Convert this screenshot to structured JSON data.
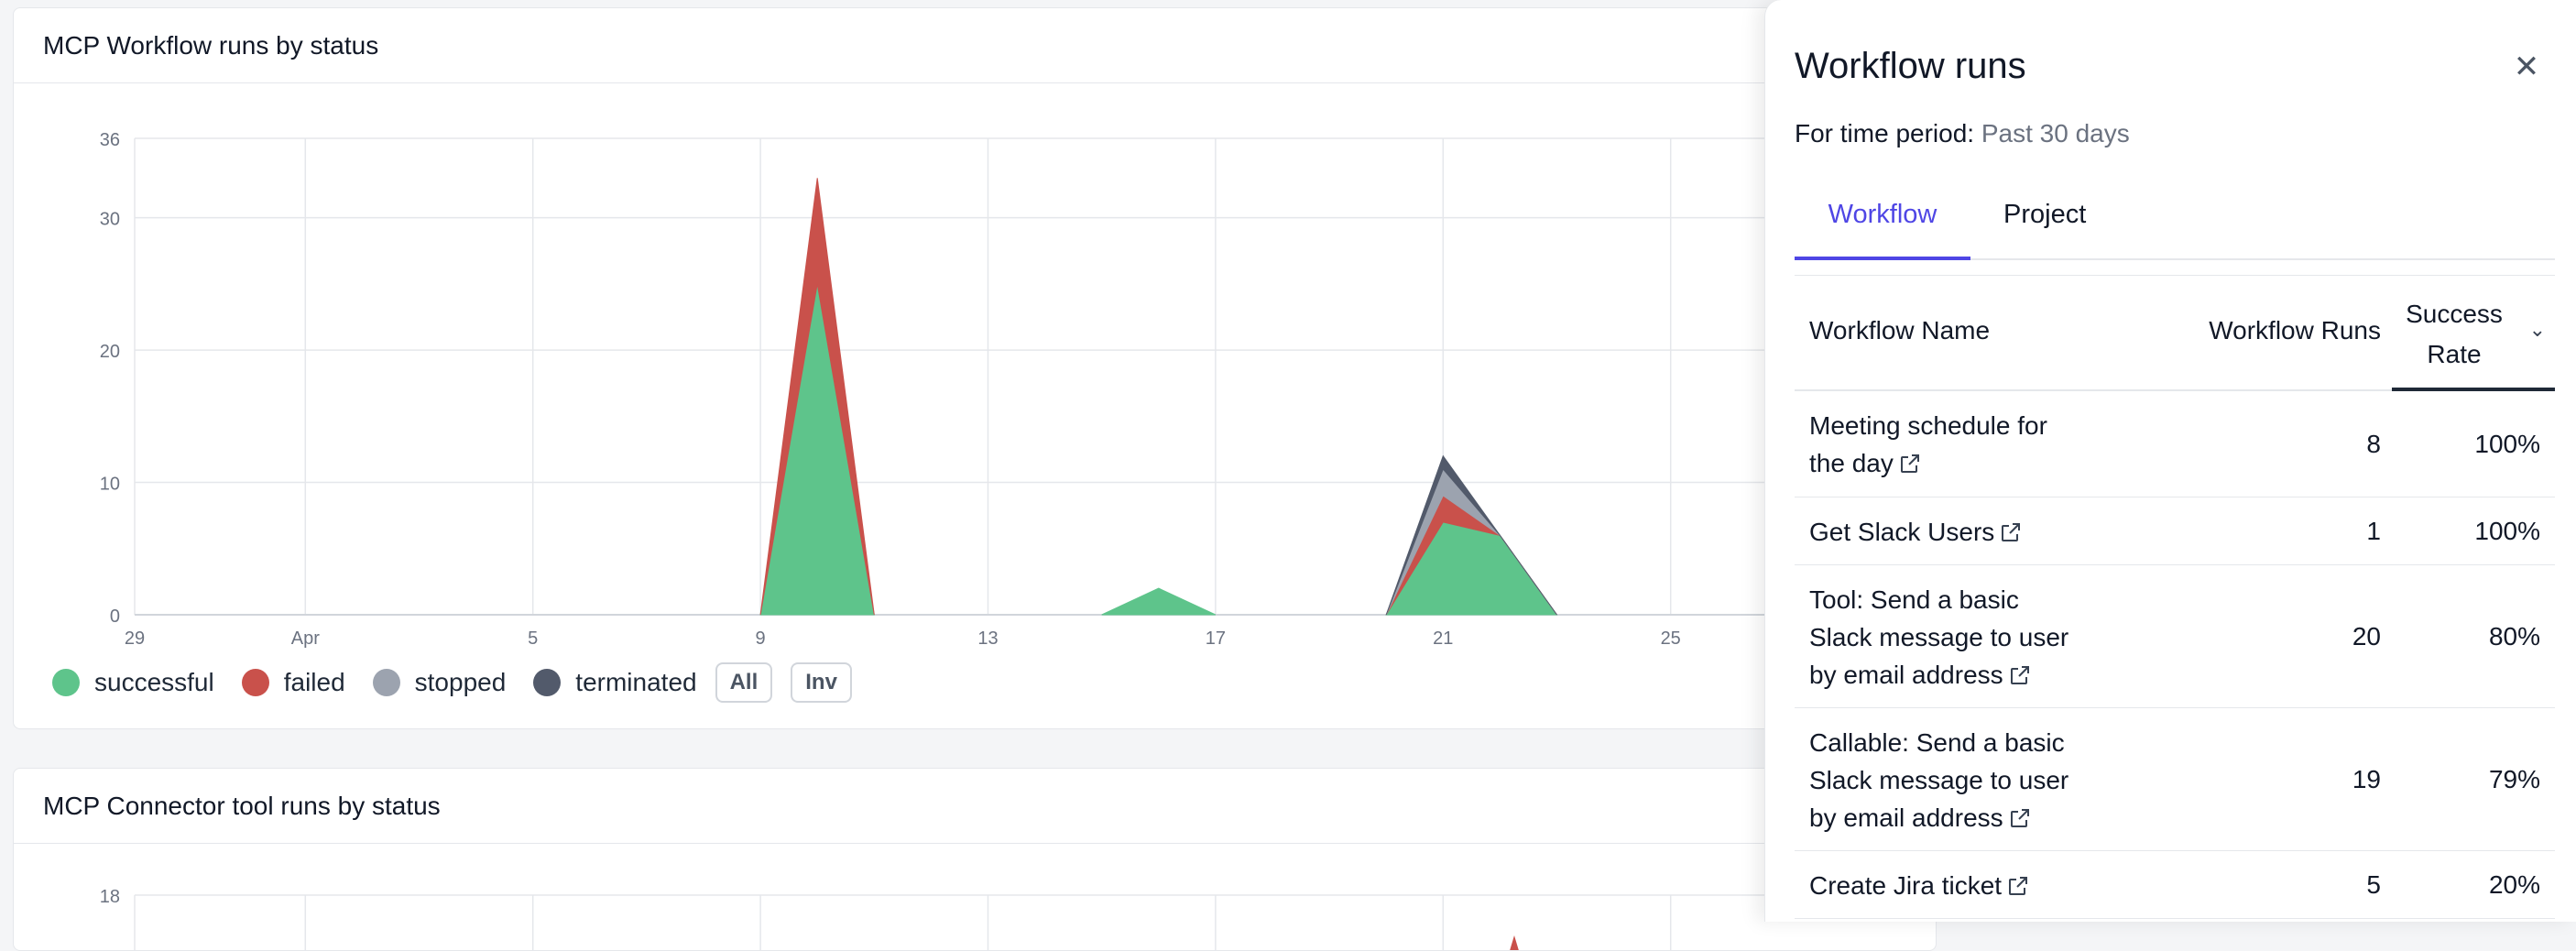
{
  "chart1": {
    "title": "MCP Workflow runs by status"
  },
  "chart2": {
    "title": "MCP Connector tool runs by status",
    "y_ticks": [
      "18"
    ]
  },
  "legend": {
    "items": [
      {
        "label": "successful",
        "color": "#5ec48b"
      },
      {
        "label": "failed",
        "color": "#c9514b"
      },
      {
        "label": "stopped",
        "color": "#9ca3af"
      },
      {
        "label": "terminated",
        "color": "#525a6b"
      }
    ],
    "all_button": "All",
    "inv_button": "Inv"
  },
  "chart_data": [
    {
      "type": "area",
      "title": "MCP Workflow runs by status",
      "x_tick_labels": [
        "29",
        "Apr",
        "5",
        "9",
        "13",
        "17",
        "21",
        "25"
      ],
      "y_ticks": [
        0,
        10,
        20,
        30,
        36
      ],
      "ylim": [
        0,
        36
      ],
      "x": [
        "Apr 9",
        "Apr 10",
        "Apr 11",
        "Apr 15",
        "Apr 16",
        "Apr 17",
        "Apr 20",
        "Apr 21",
        "Apr 22",
        "Apr 23"
      ],
      "series": [
        {
          "name": "successful",
          "values": [
            0,
            25,
            0,
            0,
            2,
            0,
            0,
            7,
            6,
            0
          ]
        },
        {
          "name": "failed",
          "values": [
            0,
            8,
            0,
            0,
            0,
            0,
            0,
            2,
            0,
            0
          ]
        },
        {
          "name": "stopped",
          "values": [
            0,
            0,
            0,
            0,
            0,
            0,
            0,
            2,
            0,
            0
          ]
        },
        {
          "name": "terminated",
          "values": [
            0,
            0,
            0,
            0,
            0,
            0,
            0,
            1,
            0,
            0
          ]
        }
      ],
      "grid": true,
      "legend": "bottom-left"
    }
  ],
  "drawer": {
    "title": "Workflow runs",
    "period_label": "For time period:",
    "period_value": "Past 30 days",
    "tabs": [
      "Workflow",
      "Project"
    ],
    "columns": {
      "name": "Workflow Name",
      "runs": "Workflow Runs",
      "rate": "Success Rate"
    },
    "rows": [
      {
        "name": "Meeting schedule for the day",
        "runs": "8",
        "rate": "100%"
      },
      {
        "name": "Get Slack Users",
        "runs": "1",
        "rate": "100%"
      },
      {
        "name": "Tool: Send a basic Slack message to user by email address",
        "runs": "20",
        "rate": "80%"
      },
      {
        "name": "Callable: Send a basic Slack message to user by email address",
        "runs": "19",
        "rate": "79%"
      },
      {
        "name": "Create Jira ticket",
        "runs": "5",
        "rate": "20%"
      }
    ]
  }
}
